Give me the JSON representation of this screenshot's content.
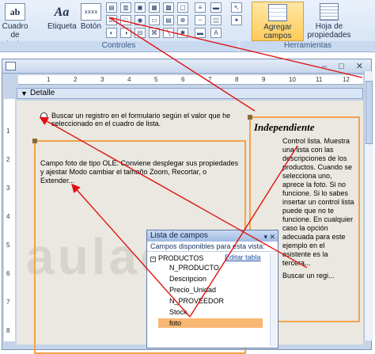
{
  "ribbon": {
    "buttons": [
      {
        "label": "Cuadro de texto",
        "icon": "textbox-icon",
        "glyph": "ab"
      },
      {
        "label": "Etiqueta",
        "icon": "label-icon",
        "glyph": "Aa"
      },
      {
        "label": "Botón",
        "icon": "button-icon",
        "glyph": "xxxx"
      }
    ],
    "group_controles": "Controles",
    "add_fields": "Agregar campos existentes",
    "property_sheet": "Hoja de propiedades",
    "group_herramientas": "Herramientas"
  },
  "form": {
    "section": "Detalle",
    "ruler_marks": [
      "1",
      "2",
      "3",
      "4",
      "5",
      "6",
      "7",
      "8",
      "9",
      "10",
      "11",
      "12"
    ],
    "radio_label": "Buscar un registro en el formulario según el valor que he seleccionado en el cuadro de lista.",
    "ole_text": "Campo foto de tipo OLE. Conviene desplegar sus propiedades y ajestar Modo cambiar el tamaño Zoom, Recortar, o Extender...",
    "indep_title": "Independiente",
    "indep_text": "Control lista. Muestra una lista con las descripciones de los productos. Cuando se selecciona uno, aprece la foto. Si no funcione. Si lo sabes insertar un control lista puede que no te funcione. En cualquier caso la opción adecuada para este ejemplo en el asistente es la tercera...",
    "indep_search": "Buscar un regi...",
    "watermark": "aulaclic"
  },
  "field_list": {
    "title": "Lista de campos",
    "subtitle": "Campos disponibles para esta vista:",
    "table": "PRODUCTOS",
    "edit": "Editar tabla",
    "fields": [
      "N_PRODUCTO",
      "Descripcion",
      "Precio_Unidad",
      "N_PROVEEDOR",
      "Stock",
      "foto"
    ],
    "selected": "foto"
  }
}
